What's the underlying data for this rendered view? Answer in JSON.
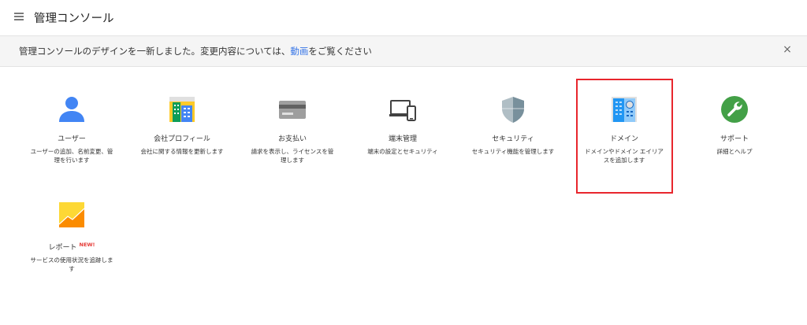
{
  "header": {
    "title": "管理コンソール"
  },
  "notice": {
    "text_before": "管理コンソールのデザインを一新しました。変更内容については、",
    "link_text": "動画",
    "text_after": "をご覧ください",
    "close": "×"
  },
  "tiles": [
    {
      "title": "ユーザー",
      "desc": "ユーザーの追加、名前変更、管理を行います",
      "icon": "user-icon"
    },
    {
      "title": "会社プロフィール",
      "desc": "会社に関する情報を更新します",
      "icon": "company-building-icon"
    },
    {
      "title": "お支払い",
      "desc": "請求を表示し、ライセンスを管理します",
      "icon": "credit-card-icon"
    },
    {
      "title": "端末管理",
      "desc": "端末の設定とセキュリティ",
      "icon": "devices-icon"
    },
    {
      "title": "セキュリティ",
      "desc": "セキュリティ機能を管理します",
      "icon": "shield-icon"
    },
    {
      "title": "ドメイン",
      "desc": "ドメインやドメイン エイリアスを追加します",
      "icon": "domain-building-icon"
    },
    {
      "title": "サポート",
      "desc": "詳細とヘルプ",
      "icon": "wrench-icon"
    },
    {
      "title": "レポート",
      "badge": "NEW!",
      "desc": "サービスの使用状況を追跡します",
      "icon": "report-chart-icon"
    }
  ],
  "colors": {
    "accent": "#3b78e7",
    "highlight": "#e8262d",
    "new_badge": "#e53935"
  }
}
